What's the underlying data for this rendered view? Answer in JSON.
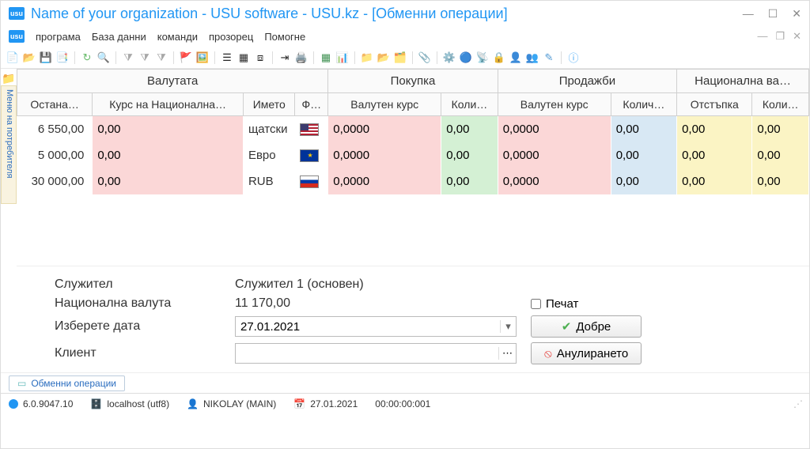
{
  "window": {
    "title": "Name of your organization - USU software - USU.kz - [Обменни операции]"
  },
  "menu": {
    "program": "програма",
    "database": "База данни",
    "commands": "команди",
    "window": "прозорец",
    "help": "Помогне"
  },
  "sidebar": {
    "userMenu": "Меню на потребителя"
  },
  "grid": {
    "groups": {
      "currency": "Валутата",
      "buy": "Покупка",
      "sell": "Продажби",
      "natcur": "Национална ва…"
    },
    "cols": {
      "remain": "Остана…",
      "rateNat": "Курс на Национална…",
      "name": "Името",
      "flag": "Ф…",
      "buyRate": "Валутен курс",
      "buyQty": "Коли…",
      "sellRate": "Валутен курс",
      "sellQty": "Колич…",
      "discount": "Отстъпка",
      "qty2": "Коли…"
    },
    "rows": [
      {
        "remain": "6 550,00",
        "rateNat": "0,00",
        "name": "щатски",
        "flag": "us",
        "buyRate": "0,0000",
        "buyQty": "0,00",
        "sellRate": "0,0000",
        "sellQty": "0,00",
        "discount": "0,00",
        "qty2": "0,00"
      },
      {
        "remain": "5 000,00",
        "rateNat": "0,00",
        "name": "Евро",
        "flag": "eu",
        "buyRate": "0,0000",
        "buyQty": "0,00",
        "sellRate": "0,0000",
        "sellQty": "0,00",
        "discount": "0,00",
        "qty2": "0,00"
      },
      {
        "remain": "30 000,00",
        "rateNat": "0,00",
        "name": "RUB",
        "flag": "ru",
        "buyRate": "0,0000",
        "buyQty": "0,00",
        "sellRate": "0,0000",
        "sellQty": "0,00",
        "discount": "0,00",
        "qty2": "0,00"
      }
    ]
  },
  "form": {
    "employeeLbl": "Служител",
    "employeeVal": "Служител 1 (основен)",
    "natCurLbl": "Национална валута",
    "natCurVal": "11 170,00",
    "dateLbl": "Изберете дата",
    "dateVal": "27.01.2021",
    "clientLbl": "Клиент",
    "clientVal": "",
    "printLbl": "Печат",
    "okBtn": "Добре",
    "cancelBtn": "Анулирането"
  },
  "tabs": {
    "main": "Обменни операции"
  },
  "status": {
    "version": "6.0.9047.10",
    "host": "localhost (utf8)",
    "user": "NIKOLAY (MAIN)",
    "date": "27.01.2021",
    "time": "00:00:00:001"
  }
}
